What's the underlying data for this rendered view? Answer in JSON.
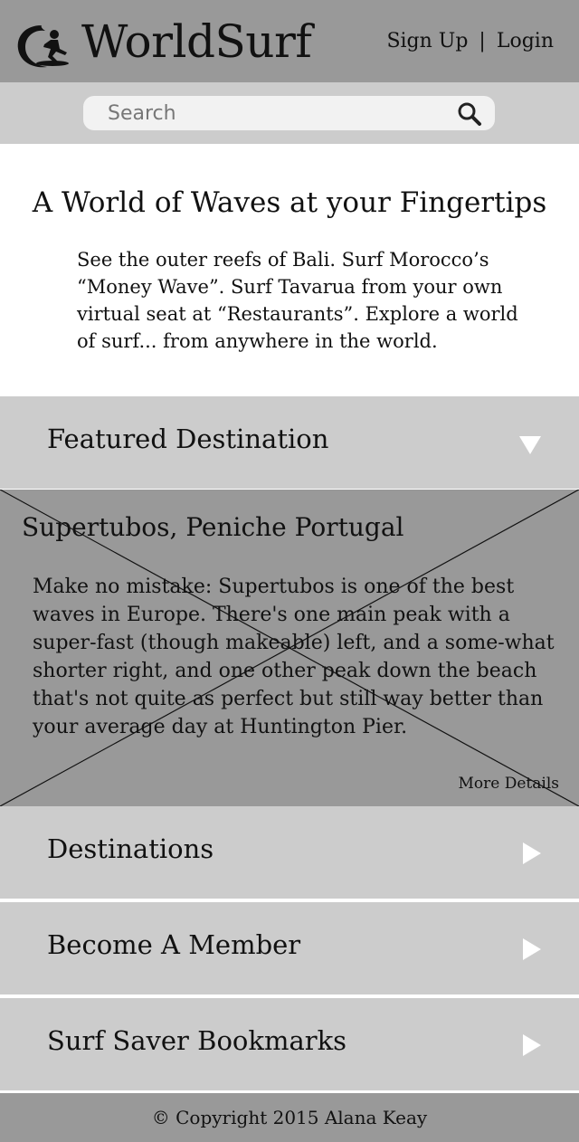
{
  "header": {
    "brand": "WorldSurf",
    "logo_icon": "surfer-wave-logo-icon",
    "signup_label": "Sign Up",
    "separator": "|",
    "login_label": "Login"
  },
  "search": {
    "placeholder": "Search",
    "value": "",
    "icon": "search-icon"
  },
  "hero": {
    "title": "A World of Waves at your Fingertips",
    "text": "See the outer reefs of Bali. Surf Morocco’s “Money Wave”. Surf Tavarua from your own virtual seat at “Restaurants”. Explore a world of surf... from anywhere in the world."
  },
  "featured_menu": {
    "label": "Featured Destination",
    "icon": "triangle-down-icon"
  },
  "featured": {
    "title": "Supertubos, Peniche Portugal",
    "text": "Make no mistake: Supertubos is one of the best waves in Europe. There's one main peak with a super-fast (though makeable) left, and a some-what shorter right, and one other peak down the beach that's not quite as perfect but still way better than your average day at Huntington Pier.",
    "more_label": "More Details",
    "image_icon": "image-placeholder-icon"
  },
  "menu": [
    {
      "label": "Destinations",
      "icon": "triangle-right-icon"
    },
    {
      "label": "Become A Member",
      "icon": "triangle-right-icon"
    },
    {
      "label": "Surf Saver Bookmarks",
      "icon": "triangle-right-icon"
    }
  ],
  "footer": {
    "copyright": "© Copyright 2015 Alana Keay"
  },
  "colors": {
    "header_bg": "#999999",
    "bar_bg": "#cccccc",
    "search_bg": "#f2f2f2",
    "arrow": "#ffffff"
  }
}
